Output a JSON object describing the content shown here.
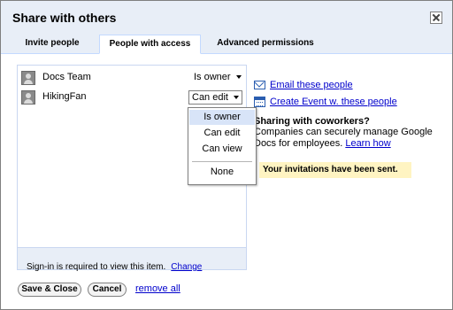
{
  "dialog": {
    "title": "Share with others",
    "close_icon": "close-icon"
  },
  "tabs": [
    {
      "label": "Invite people",
      "active": false
    },
    {
      "label": "People with access",
      "active": true
    },
    {
      "label": "Advanced permissions",
      "active": false
    }
  ],
  "people": [
    {
      "name": "Docs Team",
      "role": "Is owner"
    },
    {
      "name": "HikingFan",
      "role": "Can edit"
    }
  ],
  "role_dropdown": {
    "options": [
      "Is owner",
      "Can edit",
      "Can view",
      "None"
    ],
    "highlighted": "Is owner"
  },
  "signin": {
    "text": "Sign-in is required to view this item.",
    "link": "Change"
  },
  "side": {
    "email_link": "Email these people",
    "event_link": "Create Event w. these people",
    "sharing_title": "Sharing with coworkers?",
    "sharing_text": "Companies can securely manage Google Docs for employees.",
    "learn_more": "Learn how",
    "notice": "Your invitations have been sent."
  },
  "footer": {
    "save_label": "Save & Close",
    "cancel_label": "Cancel",
    "remove_label": "remove all"
  },
  "colors": {
    "header_bg": "#e8eef7",
    "link": "#0000cc",
    "notice_bg": "#fff4c2"
  }
}
